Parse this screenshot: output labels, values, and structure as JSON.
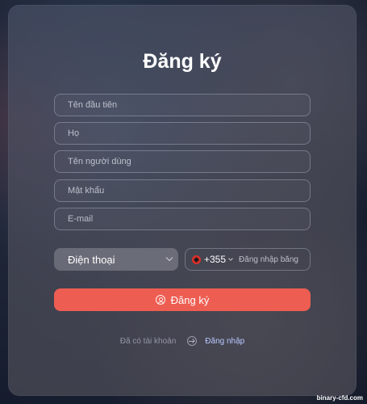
{
  "form": {
    "title": "Đăng ký",
    "first_name_placeholder": "Tên đầu tiên",
    "last_name_placeholder": "Họ",
    "username_placeholder": "Tên người dùng",
    "password_placeholder": "Mật khẩu",
    "email_placeholder": "E-mail",
    "contact_method_selected": "Điện thoại",
    "phone_country_code": "+355",
    "phone_placeholder": "Đăng nhập bằng",
    "submit_label": "Đăng ký",
    "have_account_text": "Đã có tài khoản",
    "login_link_label": "Đăng nhập"
  },
  "watermark": "binary-cfd.com",
  "colors": {
    "accent": "#ee5d52",
    "link": "#b9c9ff"
  }
}
